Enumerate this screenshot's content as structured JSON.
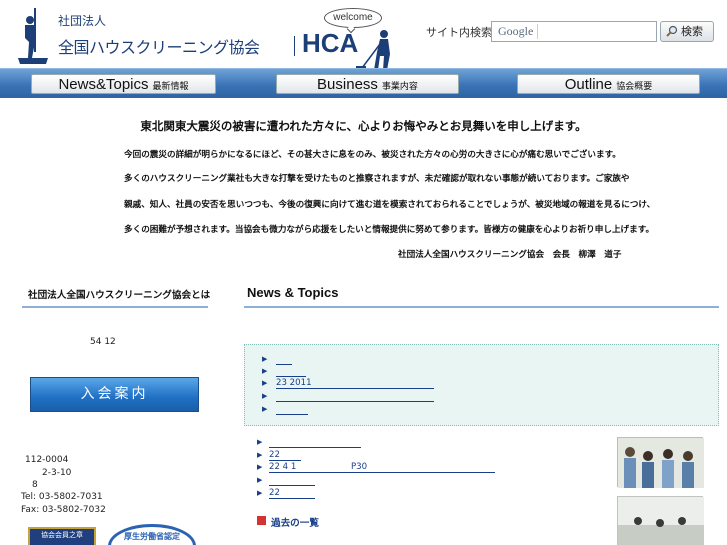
{
  "header": {
    "org_small": "社団法人",
    "org_name": "全国ハウスクリーニング協会",
    "abbr": "HCA",
    "welcome": "welcome",
    "search_label": "サイト内検索",
    "search_engine": "Google",
    "search_placeholder": "",
    "search_button": "検索"
  },
  "nav": [
    {
      "en": "News&Topics",
      "jp": "最新情報"
    },
    {
      "en": "Business",
      "jp": "事業内容"
    },
    {
      "en": "Outline",
      "jp": "協会概要"
    }
  ],
  "message": {
    "title": "東北関東大震災の被害に遭われた方々に、心よりお悔やみとお見舞いを申し上げます。",
    "lines": [
      "今回の震災の詳細が明らかになるにほど、その甚大さに息をのみ、被災された方々の心労の大きさに心が痛む思いでございます。",
      "多くのハウスクリーニング業社も大きな打撃を受けたものと推察されますが、未だ確認が取れない事態が続いております。ご家族や",
      "親戚、知人、社員の安否を思いつつも、今後の復興に向けて進む道を模索されておられることでしょうが、被災地域の報道を見るにつけ、",
      "多くの困難が予想されます。当協会も微力ながら応援をしたいと情報提供に努めて参ります。皆様方の健康を心よりお祈り申し上げます。"
    ],
    "signature": "社団法人全国ハウスクリーニング協会　会長　柳澤　道子"
  },
  "sidebar": {
    "heading": "社団法人全国ハウスクリーニング協会とは",
    "text": "54 12",
    "join_button": "入会案内",
    "postal": "112-0004",
    "addr1": "2-3-10",
    "addr2": "8",
    "tel": "Tel: 03-5802-7031",
    "fax": "Fax: 03-5802-7032",
    "badge1": "協会会員之章",
    "badge2": "厚生労働省認定"
  },
  "news": {
    "heading": "News & Topics",
    "highlight_items": [
      "",
      "",
      "23 2011",
      "",
      ""
    ],
    "items": [
      "",
      "22",
      "22 4 1                    P30",
      "",
      "22"
    ],
    "past_link": "過去の一覧"
  },
  "colors": {
    "brand": "#1d3f78",
    "nav": "#3b74b7",
    "link": "#1a3f8a",
    "highlight_bg": "#e9f5f3"
  }
}
